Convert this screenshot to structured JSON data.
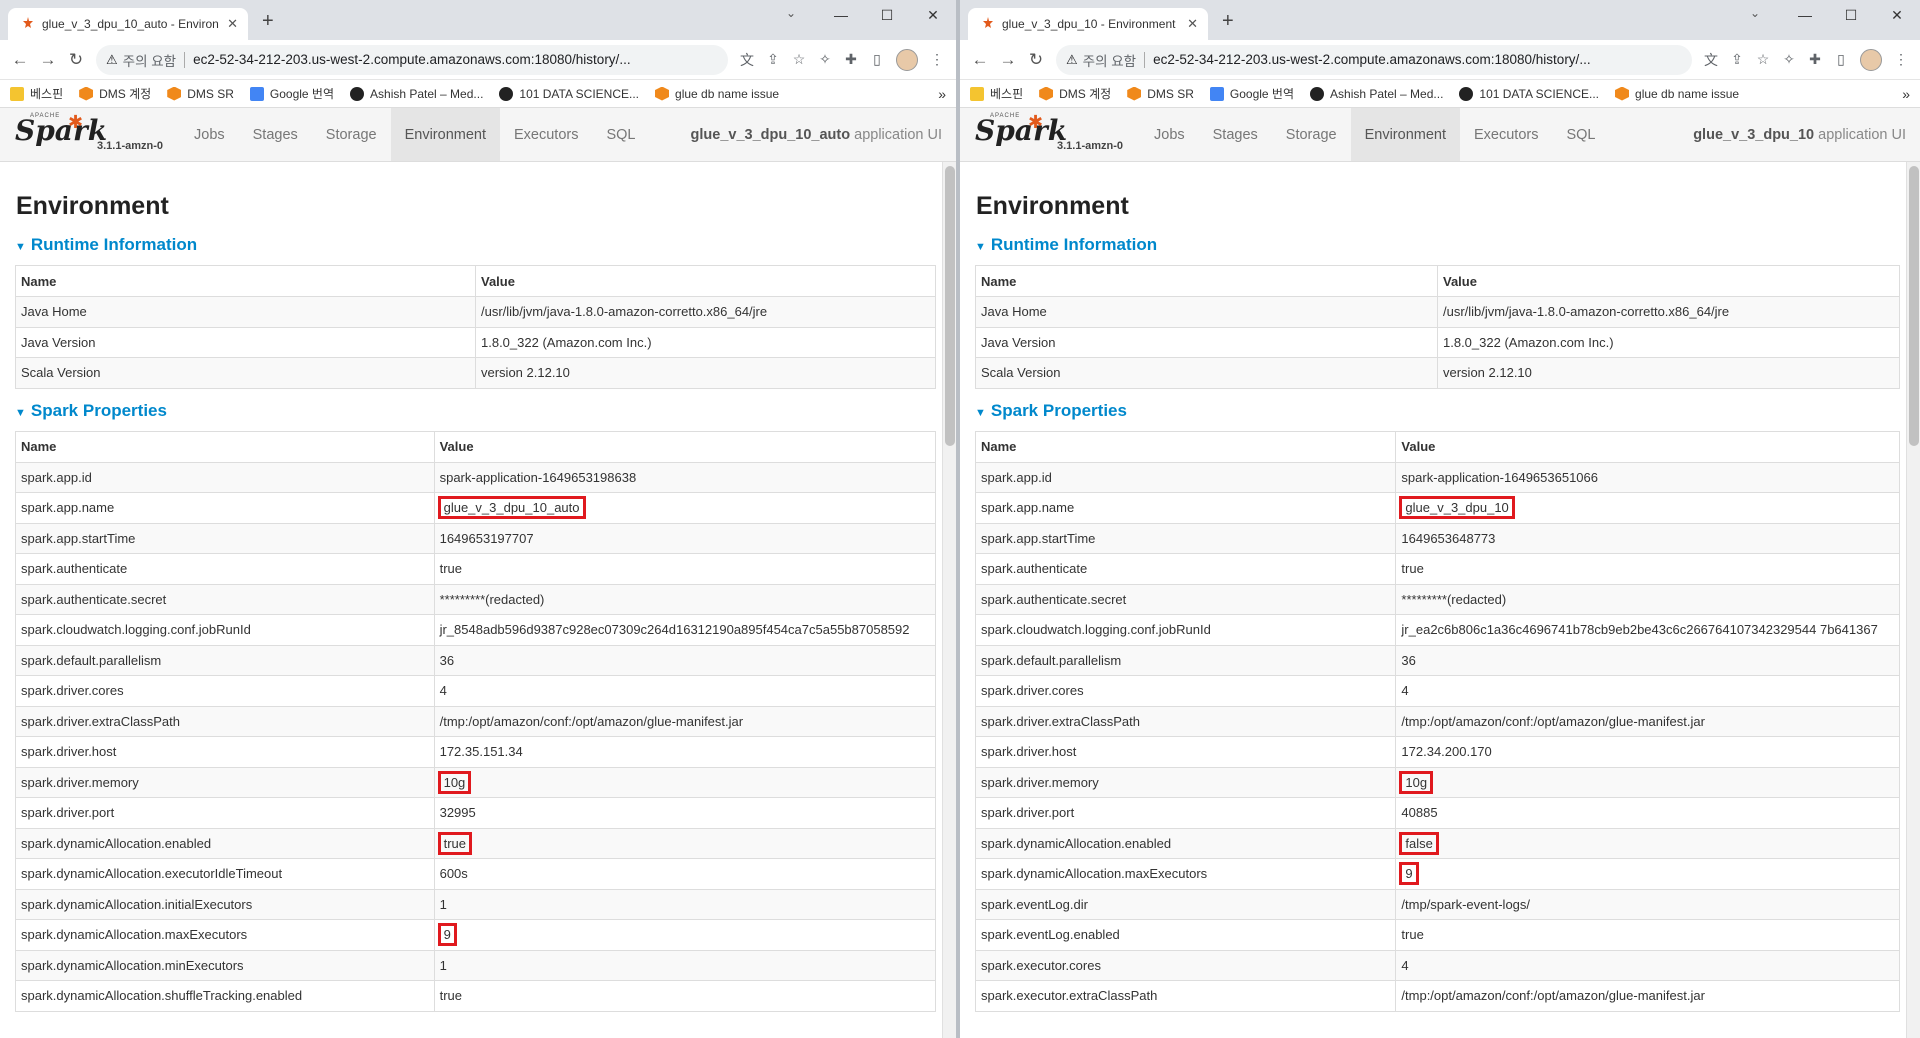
{
  "browser": {
    "left": {
      "tab_title": "glue_v_3_dpu_10_auto - Environ",
      "security_warning": "주의 요함",
      "url": "ec2-52-34-212-203.us-west-2.compute.amazonaws.com:18080/history/..."
    },
    "right": {
      "tab_title": "glue_v_3_dpu_10 - Environment",
      "security_warning": "주의 요함",
      "url": "ec2-52-34-212-203.us-west-2.compute.amazonaws.com:18080/history/..."
    },
    "bookmarks": [
      "베스핀",
      "DMS 계정",
      "DMS SR",
      "Google 번역",
      "Ashish Patel – Med...",
      "101 DATA SCIENCE...",
      "glue db name issue"
    ],
    "bookmark_more": "»"
  },
  "spark": {
    "version": "3.1.1-amzn-0",
    "apache": "APACHE",
    "logo_text": "Spark",
    "nav": [
      "Jobs",
      "Stages",
      "Storage",
      "Environment",
      "Executors",
      "SQL"
    ],
    "app_suffix": "application UI",
    "left_app": "glue_v_3_dpu_10_auto",
    "right_app": "glue_v_3_dpu_10"
  },
  "page": {
    "title": "Environment",
    "runtime_heading": "Runtime Information",
    "spark_props_heading": "Spark Properties",
    "col_name": "Name",
    "col_value": "Value"
  },
  "runtime": [
    {
      "name": "Java Home",
      "value": "/usr/lib/jvm/java-1.8.0-amazon-corretto.x86_64/jre"
    },
    {
      "name": "Java Version",
      "value": "1.8.0_322 (Amazon.com Inc.)"
    },
    {
      "name": "Scala Version",
      "value": "version 2.12.10"
    }
  ],
  "left_props": [
    {
      "name": "spark.app.id",
      "value": "spark-application-1649653198638"
    },
    {
      "name": "spark.app.name",
      "value": "glue_v_3_dpu_10_auto",
      "highlight": true
    },
    {
      "name": "spark.app.startTime",
      "value": "1649653197707"
    },
    {
      "name": "spark.authenticate",
      "value": "true"
    },
    {
      "name": "spark.authenticate.secret",
      "value": "*********(redacted)"
    },
    {
      "name": "spark.cloudwatch.logging.conf.jobRunId",
      "value": "jr_8548adb596d9387c928ec07309c264d16312190a895f454ca7c5a55b87058592"
    },
    {
      "name": "spark.default.parallelism",
      "value": "36"
    },
    {
      "name": "spark.driver.cores",
      "value": "4"
    },
    {
      "name": "spark.driver.extraClassPath",
      "value": "/tmp:/opt/amazon/conf:/opt/amazon/glue-manifest.jar"
    },
    {
      "name": "spark.driver.host",
      "value": "172.35.151.34"
    },
    {
      "name": "spark.driver.memory",
      "value": "10g",
      "highlight": true
    },
    {
      "name": "spark.driver.port",
      "value": "32995"
    },
    {
      "name": "spark.dynamicAllocation.enabled",
      "value": "true",
      "highlight": true
    },
    {
      "name": "spark.dynamicAllocation.executorIdleTimeout",
      "value": "600s"
    },
    {
      "name": "spark.dynamicAllocation.initialExecutors",
      "value": "1"
    },
    {
      "name": "spark.dynamicAllocation.maxExecutors",
      "value": "9",
      "highlight": true
    },
    {
      "name": "spark.dynamicAllocation.minExecutors",
      "value": "1"
    },
    {
      "name": "spark.dynamicAllocation.shuffleTracking.enabled",
      "value": "true"
    }
  ],
  "right_props": [
    {
      "name": "spark.app.id",
      "value": "spark-application-1649653651066"
    },
    {
      "name": "spark.app.name",
      "value": "glue_v_3_dpu_10",
      "highlight": true
    },
    {
      "name": "spark.app.startTime",
      "value": "1649653648773"
    },
    {
      "name": "spark.authenticate",
      "value": "true"
    },
    {
      "name": "spark.authenticate.secret",
      "value": "*********(redacted)"
    },
    {
      "name": "spark.cloudwatch.logging.conf.jobRunId",
      "value": "jr_ea2c6b806c1a36c4696741b78cb9eb2be43c6c266764107342329544 7b641367"
    },
    {
      "name": "spark.default.parallelism",
      "value": "36"
    },
    {
      "name": "spark.driver.cores",
      "value": "4"
    },
    {
      "name": "spark.driver.extraClassPath",
      "value": "/tmp:/opt/amazon/conf:/opt/amazon/glue-manifest.jar"
    },
    {
      "name": "spark.driver.host",
      "value": "172.34.200.170"
    },
    {
      "name": "spark.driver.memory",
      "value": "10g",
      "highlight": true
    },
    {
      "name": "spark.driver.port",
      "value": "40885"
    },
    {
      "name": "spark.dynamicAllocation.enabled",
      "value": "false",
      "highlight": true
    },
    {
      "name": "spark.dynamicAllocation.maxExecutors",
      "value": "9",
      "highlight": true
    },
    {
      "name": "spark.eventLog.dir",
      "value": "/tmp/spark-event-logs/"
    },
    {
      "name": "spark.eventLog.enabled",
      "value": "true"
    },
    {
      "name": "spark.executor.cores",
      "value": "4"
    },
    {
      "name": "spark.executor.extraClassPath",
      "value": "/tmp:/opt/amazon/conf:/opt/amazon/glue-manifest.jar"
    }
  ]
}
